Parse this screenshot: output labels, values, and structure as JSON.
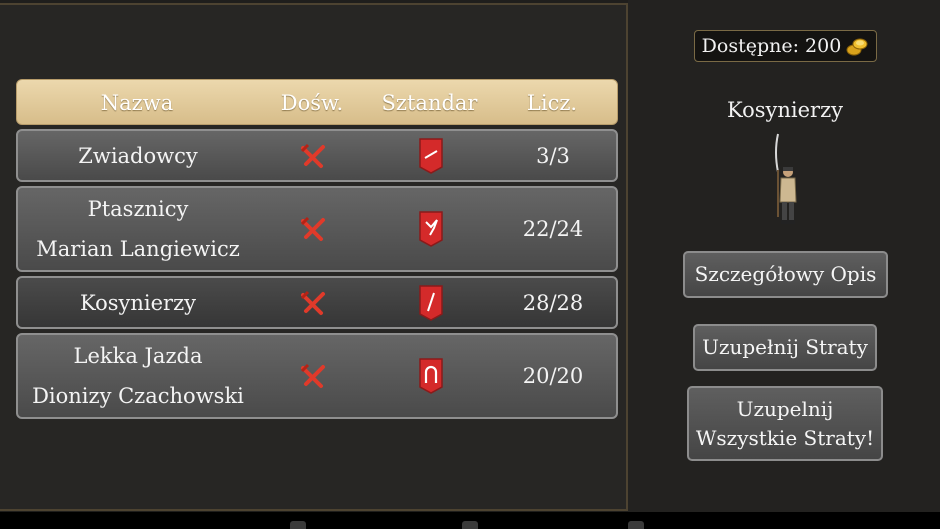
{
  "header": {
    "col_name": "Nazwa",
    "col_exp": "Dośw.",
    "col_banner": "Sztandar",
    "col_count": "Licz."
  },
  "rows": [
    {
      "name": "Zwiadowcy",
      "commander": "",
      "count": "3/3",
      "banner_icon": "spear-banner-icon",
      "exp_icon": "crossed-swords-icon"
    },
    {
      "name": "Ptasznicy",
      "commander": "Marian Langiewicz",
      "count": "22/24",
      "banner_icon": "bird-banner-icon",
      "exp_icon": "crossed-swords-icon"
    },
    {
      "name": "Kosynierzy",
      "commander": "",
      "count": "28/28",
      "banner_icon": "scythe-banner-icon",
      "exp_icon": "crossed-swords-icon"
    },
    {
      "name": "Lekka Jazda",
      "commander": "Dionizy Czachowski",
      "count": "20/20",
      "banner_icon": "horseshoe-banner-icon",
      "exp_icon": "crossed-swords-icon"
    }
  ],
  "sidebar": {
    "available_label": "Dostępne: 200",
    "selected_unit": "Kosynierzy",
    "details_button": "Szczegółowy Opis",
    "replenish_button": "Uzupełnij Straty",
    "replenish_all_line1": "Uzupelnij",
    "replenish_all_line2": "Wszystkie Straty!"
  },
  "colors": {
    "header_bg": "#e3cc9c",
    "banner_red": "#d42a2a",
    "x_red": "#e03a2a",
    "frame_gold": "#4d4331"
  }
}
